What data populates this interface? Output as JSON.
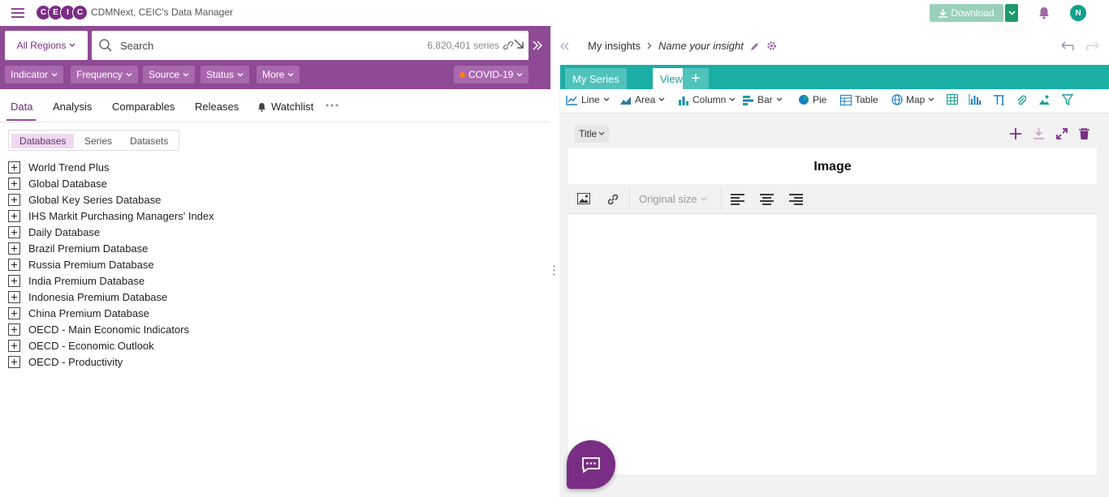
{
  "app": {
    "logo_letters": [
      "C",
      "E",
      "I",
      "C"
    ],
    "title": "CDMNext, CEIC's Data Manager",
    "download_label": "Download",
    "avatar_initial": "N"
  },
  "search": {
    "region_label": "All Regions",
    "placeholder": "Search",
    "series_count": "6,820,401 series"
  },
  "filters": [
    {
      "label": "Indicator"
    },
    {
      "label": "Frequency"
    },
    {
      "label": "Source"
    },
    {
      "label": "Status"
    },
    {
      "label": "More"
    }
  ],
  "covid_label": "COVID-19",
  "left_tabs": [
    {
      "label": "Data"
    },
    {
      "label": "Analysis"
    },
    {
      "label": "Comparables"
    },
    {
      "label": "Releases"
    },
    {
      "label": "Watchlist"
    }
  ],
  "sub_tabs": [
    {
      "label": "Databases"
    },
    {
      "label": "Series"
    },
    {
      "label": "Datasets"
    }
  ],
  "databases": [
    "World Trend Plus",
    "Global Database",
    "Global Key Series Database",
    "IHS Markit Purchasing Managers' Index",
    "Daily Database",
    "Brazil Premium Database",
    "Russia Premium Database",
    "India Premium Database",
    "Indonesia Premium Database",
    "China Premium Database",
    "OECD - Main Economic Indicators",
    "OECD - Economic Outlook",
    "OECD - Productivity"
  ],
  "insight": {
    "breadcrumb_root": "My insights",
    "name_placeholder": "Name your insight"
  },
  "view_tabs": {
    "my_series": "My Series",
    "view1": "View 1",
    "add": "+"
  },
  "chart_tools": [
    {
      "label": "Line"
    },
    {
      "label": "Area"
    },
    {
      "label": "Column"
    },
    {
      "label": "Bar"
    },
    {
      "label": "Pie"
    },
    {
      "label": "Table"
    },
    {
      "label": "Map"
    }
  ],
  "title_dropdown": "Title",
  "image_card": {
    "title": "Image",
    "size_label": "Original size"
  },
  "colors": {
    "brand_purple": "#8e4a94",
    "teal": "#1aaea5",
    "download_green": "#9ad0b8",
    "covid_dot": "#ff7a1a"
  }
}
